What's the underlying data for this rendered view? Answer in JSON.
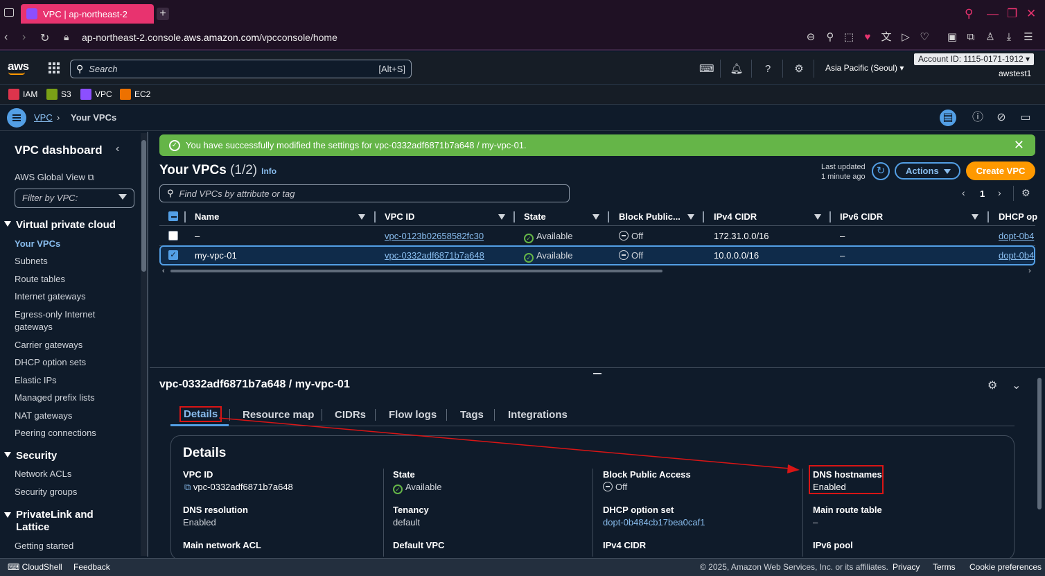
{
  "browser": {
    "tab_title": "VPC | ap-northeast-2",
    "url_prefix": "ap-northeast-2.console.",
    "url_host": "aws.amazon.com",
    "url_path": "/vpcconsole/home"
  },
  "header": {
    "search_placeholder": "Search",
    "search_shortcut": "[Alt+S]",
    "region": "Asia Pacific (Seoul)",
    "account": "Account ID: 1115-0171-1912",
    "user": "awstest1"
  },
  "favorites": [
    "IAM",
    "S3",
    "VPC",
    "EC2"
  ],
  "colors": {
    "iam": "#dd344c",
    "s3": "#7aa116",
    "vpc": "#8c4fff",
    "ec2": "#ed7100",
    "accent": "#539fe5",
    "success": "#65b548",
    "create": "#ff9900",
    "highlight": "#d91515"
  },
  "breadcrumb": {
    "root": "VPC",
    "current": "Your VPCs"
  },
  "sidebar": {
    "title": "VPC dashboard",
    "global_view": "AWS Global View",
    "filter_placeholder": "Filter by VPC:",
    "sections": [
      {
        "label": "Virtual private cloud"
      },
      {
        "label": "Security"
      },
      {
        "label": "PrivateLink and Lattice"
      }
    ],
    "vpc_items": [
      "Your VPCs",
      "Subnets",
      "Route tables",
      "Internet gateways",
      "Egress-only Internet gateways",
      "Carrier gateways",
      "DHCP option sets",
      "Elastic IPs",
      "Managed prefix lists",
      "NAT gateways",
      "Peering connections"
    ],
    "security_items": [
      "Network ACLs",
      "Security groups"
    ],
    "privatelink_items": [
      "Getting started"
    ]
  },
  "flash": {
    "message": "You have successfully modified the settings for vpc-0332adf6871b7a648 / my-vpc-01."
  },
  "list": {
    "title": "Your VPCs",
    "count": "(1/2)",
    "info": "Info",
    "last_updated_line1": "Last updated",
    "last_updated_line2": "1 minute ago",
    "actions": "Actions",
    "create": "Create VPC",
    "find_placeholder": "Find VPCs by attribute or tag",
    "page": "1",
    "columns": [
      "Name",
      "VPC ID",
      "State",
      "Block Public...",
      "IPv4 CIDR",
      "IPv6 CIDR",
      "DHCP op"
    ],
    "rows": [
      {
        "name": "–",
        "vpc_id": "vpc-0123b02658582fc30",
        "state": "Available",
        "block": "Off",
        "ipv4": "172.31.0.0/16",
        "ipv6": "–",
        "dhcp": "dopt-0b4",
        "selected": false
      },
      {
        "name": "my-vpc-01",
        "vpc_id": "vpc-0332adf6871b7a648",
        "state": "Available",
        "block": "Off",
        "ipv4": "10.0.0.0/16",
        "ipv6": "–",
        "dhcp": "dopt-0b4",
        "selected": true
      }
    ]
  },
  "detail": {
    "title": "vpc-0332adf6871b7a648 / my-vpc-01",
    "tabs": [
      "Details",
      "Resource map",
      "CIDRs",
      "Flow logs",
      "Tags",
      "Integrations"
    ],
    "section_title": "Details",
    "fields": {
      "vpc_id_label": "VPC ID",
      "vpc_id": "vpc-0332adf6871b7a648",
      "state_label": "State",
      "state": "Available",
      "block_label": "Block Public Access",
      "block": "Off",
      "dns_hostnames_label": "DNS hostnames",
      "dns_hostnames": "Enabled",
      "dns_resolution_label": "DNS resolution",
      "dns_resolution": "Enabled",
      "tenancy_label": "Tenancy",
      "tenancy": "default",
      "dhcp_label": "DHCP option set",
      "dhcp": "dopt-0b484cb17bea0caf1",
      "main_rt_label": "Main route table",
      "main_rt": "–",
      "main_acl_label": "Main network ACL",
      "default_vpc_label": "Default VPC",
      "ipv4_label": "IPv4 CIDR",
      "ipv6_pool_label": "IPv6 pool"
    }
  },
  "footer": {
    "cloudshell": "CloudShell",
    "feedback": "Feedback",
    "copyright": "© 2025, Amazon Web Services, Inc. or its affiliates.",
    "privacy": "Privacy",
    "terms": "Terms",
    "cookies": "Cookie preferences"
  }
}
